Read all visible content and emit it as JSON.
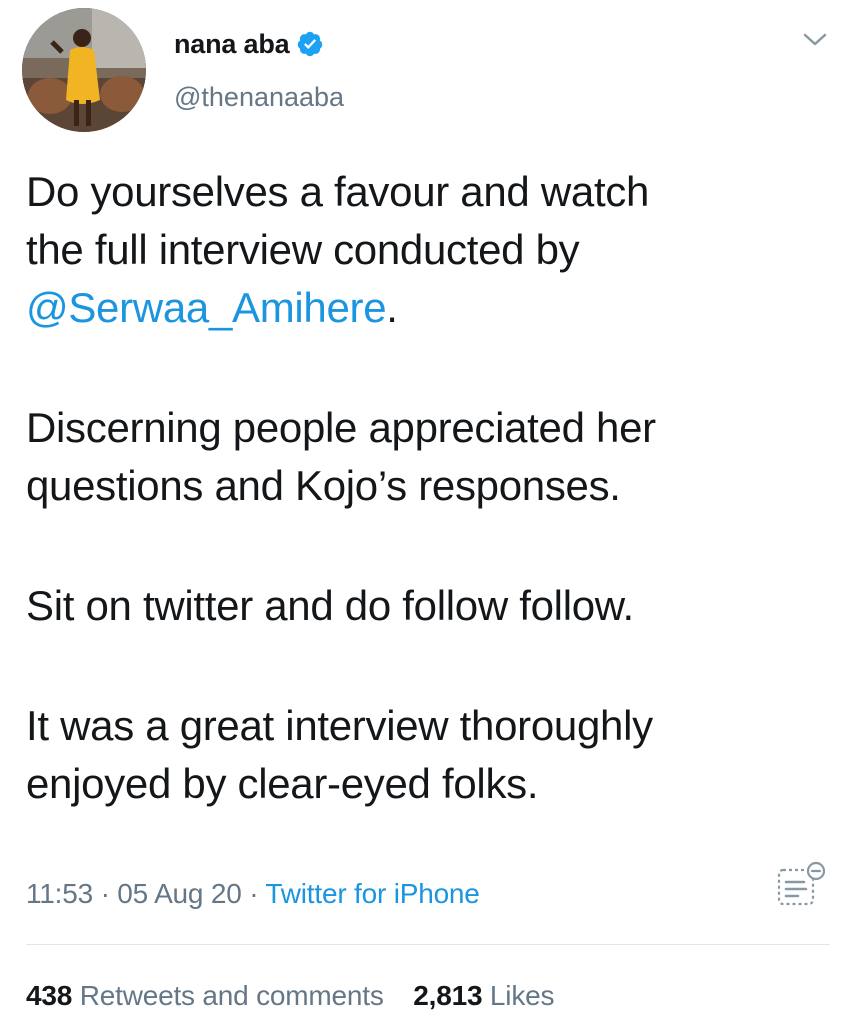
{
  "user": {
    "display_name": "nana aba",
    "handle": "@thenanaaba",
    "verified": true
  },
  "tweet": {
    "line1": "Do yourselves a favour and watch",
    "line2": "the full interview conducted by",
    "mention": "@Serwaa_Amihere",
    "mention_suffix": ".",
    "para2_line1": "Discerning people appreciated her",
    "para2_line2": "questions and Kojo’s responses.",
    "para3_line1": "Sit on twitter and do follow follow.",
    "para4_line1": "It was a great interview thoroughly",
    "para4_line2": "enjoyed by clear-eyed folks."
  },
  "meta": {
    "time": "11:53",
    "sep1": " · ",
    "date": "05 Aug 20",
    "sep2": " · ",
    "source": "Twitter for iPhone"
  },
  "stats": {
    "retweets_count": "438",
    "retweets_label": "Retweets and comments",
    "likes_count": "2,813",
    "likes_label": "Likes"
  },
  "colors": {
    "accent": "#1b95e0",
    "secondary_text": "#657786",
    "primary_text": "#14171a",
    "divider": "#e1e8ed"
  },
  "icons": {
    "verified": "verified-badge-icon",
    "caret": "chevron-down-icon",
    "analytics": "analytics-icon"
  }
}
